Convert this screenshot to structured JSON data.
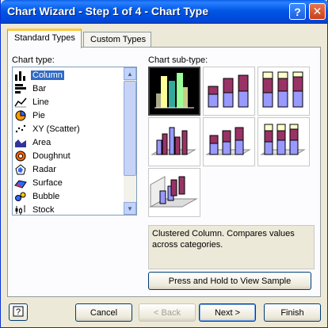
{
  "window": {
    "title": "Chart Wizard - Step 1 of 4 - Chart Type",
    "help_glyph": "?",
    "close_glyph": "✕"
  },
  "tabs": [
    {
      "label": "Standard Types",
      "active": true
    },
    {
      "label": "Custom Types",
      "active": false
    }
  ],
  "chart_type_label": "Chart type:",
  "chart_types": [
    {
      "label": "Column",
      "icon": "column-chart-icon",
      "selected": true
    },
    {
      "label": "Bar",
      "icon": "bar-chart-icon"
    },
    {
      "label": "Line",
      "icon": "line-chart-icon"
    },
    {
      "label": "Pie",
      "icon": "pie-chart-icon"
    },
    {
      "label": "XY (Scatter)",
      "icon": "scatter-chart-icon"
    },
    {
      "label": "Area",
      "icon": "area-chart-icon"
    },
    {
      "label": "Doughnut",
      "icon": "doughnut-chart-icon"
    },
    {
      "label": "Radar",
      "icon": "radar-chart-icon"
    },
    {
      "label": "Surface",
      "icon": "surface-chart-icon"
    },
    {
      "label": "Bubble",
      "icon": "bubble-chart-icon"
    },
    {
      "label": "Stock",
      "icon": "stock-chart-icon"
    }
  ],
  "sub_type_label": "Chart sub-type:",
  "sub_types": [
    {
      "name": "clustered-column",
      "selected": true
    },
    {
      "name": "stacked-column"
    },
    {
      "name": "100-stacked-column"
    },
    {
      "name": "3d-clustered-column"
    },
    {
      "name": "3d-stacked-column"
    },
    {
      "name": "3d-100-stacked-column"
    },
    {
      "name": "3d-column"
    }
  ],
  "description": "Clustered Column. Compares values across categories.",
  "sample_button": "Press and Hold to View Sample",
  "buttons": {
    "cancel": "Cancel",
    "back": "< Back",
    "next": "Next >",
    "finish": "Finish"
  },
  "colors": {
    "series1": "#9999ff",
    "series2": "#993366",
    "series3": "#ffffcc",
    "selected_bg": "#000000"
  }
}
